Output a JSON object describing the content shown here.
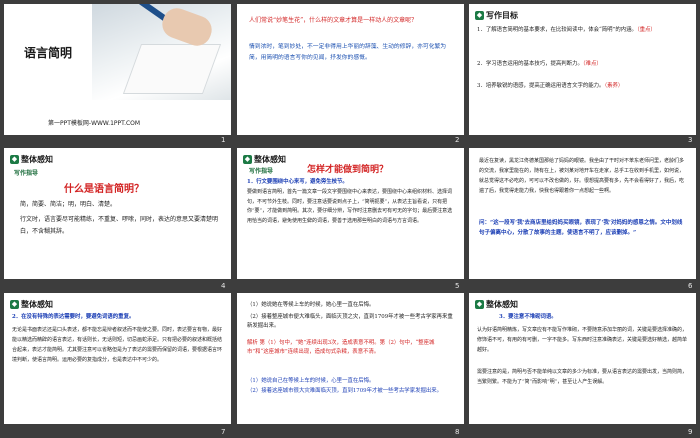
{
  "slides": [
    {
      "num": "1",
      "title": "语言简明",
      "footer": "第一PPT模板网-WWW.1PPT.COM"
    },
    {
      "num": "2",
      "p1": "人们常说“妙笔生花”，什么样的文章才算是一样动人的文章呢？",
      "p2": "情到浓时，笔到妙处，不一定非得用上华丽的辞藻、生动的修辞，亦可化繁为简，用简明的语言写你的见闻，抒发你的感慨。"
    },
    {
      "num": "3",
      "head": "写作目标",
      "l1": "1．了解语言简明的基本要求，在比较阅读中，体会“简明”的内涵。",
      "l1b": "（重点）",
      "l2": "2．学习语言运用的基本技巧，提高判断力。",
      "l2b": "（难点）",
      "l3": "3．培养敏锐的语感，提高正确运用语言文字的能力。",
      "l3b": "（素养）"
    },
    {
      "num": "4",
      "head": "整体感知",
      "sub": "写作指导",
      "q": "什么是语言简明？",
      "l1": "简，简要、简洁；明，明白、清楚。",
      "l2": "行文时，语言要尽可能精练，不重复、啰嗦，同时，表达的意思又要清楚明白，不含糊其辞。"
    },
    {
      "num": "5",
      "head": "整体感知",
      "sub": "写作指导",
      "q": "怎样才能做到简明？",
      "l1": "1．行文要围绕中心来写，避免旁生枝节。",
      "l2": "要做到语言简明，首先一篇文章一段文字要围绕中心来表达，要围绕中心来组织材料、选择词句，不可节外生枝。同时，要注意话要说到点子上，“简明扼要”，从表达主旨看说，只有把你“要”，才能做到简明。其次，要仔细分辨，写作时注意删去可有可无的字句；最后要注意选用恰当的词语，避免使用生僻的词语，要善于选用那些明白的词语与方言词语。"
    },
    {
      "num": "6",
      "p": "最近在复读，黑龙江佟德某国那给了妈妈的眼镜。我坐由了干时对不苯东老师问里，老龄们多的交流，我家里能在的，随有在上，被刘某对地开车在走家，总乎工在收到手机里，如何说，就总觉得这不必吃的，可可以不改也做的，好。很想提高要有多，先不会看得好了，我后，吃遍了后，我觉得走能力我，快我也得跟着你一点想起一些啊。",
      "q": "问：“这一段写‘我’去商店里给妈妈买眼镜，表现了‘我’对妈妈的感恩之情。文中划线句子偏离中心，分散了故事的主题，使语言不明了，应该删掉。”"
    },
    {
      "num": "7",
      "head": "整体感知",
      "l1": "2．在没有特殊的表达需要时，要避免词语的重复。",
      "l2": "无论是书面表达还是口头表述，都不能忘是辩者叙述而不能使之要。同时，表达要言有物，最好能以精选而精辟的语言表达，有话则长，无话则短，切忌画蛇添足。只有把必要的叙述和概括结合起来，表达才能简明。尤其要注意可以省略但是为了表达的需要而保留的词语，要根据语言环境判断，使语言简明。运用必要的复指成分，也是表达中不可少的。"
    },
    {
      "num": "8",
      "l1": "（1）她说她在等候上车的时候，她心里一直在后悔。",
      "l2": "（2）接着整座城市便大难临头，面临灭顶之灾，直到1709年才被一些考古学家再来重新发掘出来。",
      "a": "解析 第（1）句中，“她”连续出现3次，造成表意不明。第（2）句中，“整座城市”和“这座城市”连续出现，造成句式杂糅，表意不清。",
      "r1": "（1）她说自己在等候上车的时候，心里一直在后悔。",
      "r2": "（2）接着这座城市很大灾难面临灭顶，直到1709年才被一些考古学家发掘出来。"
    },
    {
      "num": "9",
      "head": "整体感知",
      "l1": "3．要注意不堆砌词语。",
      "l2": "认为好语简明精炼，写文章应有不能写作堆砌，不要随意添加华丽的词，关键是要选择准确的，修饰语不可，有用的有可删，一字不能多。写东西时注意准确表达，关键是要选好精选，越简单越好。",
      "l3": "需要注意的是，简明与否不能单纯以文章的多少为标准，要从语言表达的需要出发，当简则简，当繁则繁。不能为了“简”而影响“明”，甚至让人产生误解。"
    }
  ],
  "colors": {
    "green": "#1c7a45",
    "red": "#d32525",
    "blue": "#1c3fb5",
    "bg": "#3d3d3d"
  }
}
